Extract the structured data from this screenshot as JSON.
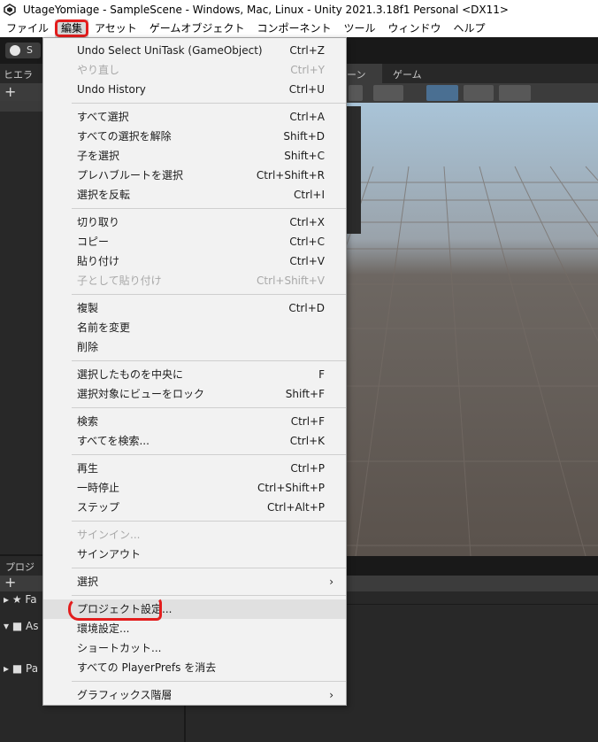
{
  "window": {
    "title": "UtageYomiage - SampleScene - Windows, Mac, Linux - Unity 2021.3.18f1 Personal <DX11>"
  },
  "menubar": {
    "items": [
      "ファイル",
      "編集",
      "アセット",
      "ゲームオブジェクト",
      "コンポーネント",
      "ツール",
      "ウィンドウ",
      "ヘルプ"
    ],
    "active": "編集"
  },
  "editor": {
    "account_label": "S",
    "hierarchy_tab": "ヒエラ",
    "scene_tab": "ーン",
    "game_tab": "ゲーム",
    "project_tab": "プロジ",
    "project_tree": [
      {
        "label": "Fa"
      },
      {
        "label": "As"
      },
      {
        "label": "Pa"
      }
    ]
  },
  "edit_menu": {
    "items": [
      {
        "label": "Undo Select UniTask (GameObject)",
        "shortcut": "Ctrl+Z",
        "disabled": false
      },
      {
        "label": "やり直し",
        "shortcut": "Ctrl+Y",
        "disabled": true
      },
      {
        "label": "Undo History",
        "shortcut": "Ctrl+U",
        "disabled": false
      },
      {
        "label": "すべて選択",
        "shortcut": "Ctrl+A",
        "disabled": false
      },
      {
        "label": "すべての選択を解除",
        "shortcut": "Shift+D",
        "disabled": false
      },
      {
        "label": "子を選択",
        "shortcut": "Shift+C",
        "disabled": false
      },
      {
        "label": "プレハブルートを選択",
        "shortcut": "Ctrl+Shift+R",
        "disabled": false
      },
      {
        "label": "選択を反転",
        "shortcut": "Ctrl+I",
        "disabled": false
      },
      {
        "label": "切り取り",
        "shortcut": "Ctrl+X",
        "disabled": false
      },
      {
        "label": "コピー",
        "shortcut": "Ctrl+C",
        "disabled": false
      },
      {
        "label": "貼り付け",
        "shortcut": "Ctrl+V",
        "disabled": false
      },
      {
        "label": "子として貼り付け",
        "shortcut": "Ctrl+Shift+V",
        "disabled": true
      },
      {
        "label": "複製",
        "shortcut": "Ctrl+D",
        "disabled": false
      },
      {
        "label": "名前を変更",
        "shortcut": "",
        "disabled": false
      },
      {
        "label": "削除",
        "shortcut": "",
        "disabled": false
      },
      {
        "label": "選択したものを中央に",
        "shortcut": "F",
        "disabled": false
      },
      {
        "label": "選択対象にビューをロック",
        "shortcut": "Shift+F",
        "disabled": false
      },
      {
        "label": "検索",
        "shortcut": "Ctrl+F",
        "disabled": false
      },
      {
        "label": "すべてを検索...",
        "shortcut": "Ctrl+K",
        "disabled": false
      },
      {
        "label": "再生",
        "shortcut": "Ctrl+P",
        "disabled": false
      },
      {
        "label": "一時停止",
        "shortcut": "Ctrl+Shift+P",
        "disabled": false
      },
      {
        "label": "ステップ",
        "shortcut": "Ctrl+Alt+P",
        "disabled": false
      },
      {
        "label": "サインイン...",
        "shortcut": "",
        "disabled": true
      },
      {
        "label": "サインアウト",
        "shortcut": "",
        "disabled": false
      },
      {
        "label": "選択",
        "shortcut": "",
        "disabled": false,
        "submenu": true
      },
      {
        "label": "プロジェクト設定...",
        "shortcut": "",
        "disabled": false,
        "highlighted": true
      },
      {
        "label": "環境設定...",
        "shortcut": "",
        "disabled": false
      },
      {
        "label": "ショートカット...",
        "shortcut": "",
        "disabled": false
      },
      {
        "label": "すべての PlayerPrefs を消去",
        "shortcut": "",
        "disabled": false
      },
      {
        "label": "グラフィックス階層",
        "shortcut": "",
        "disabled": false,
        "submenu": true
      }
    ]
  },
  "colors": {
    "annotation": "#e31d1d",
    "menu_bg": "#f2f2f2",
    "disabled_text": "#a8a8a8"
  }
}
